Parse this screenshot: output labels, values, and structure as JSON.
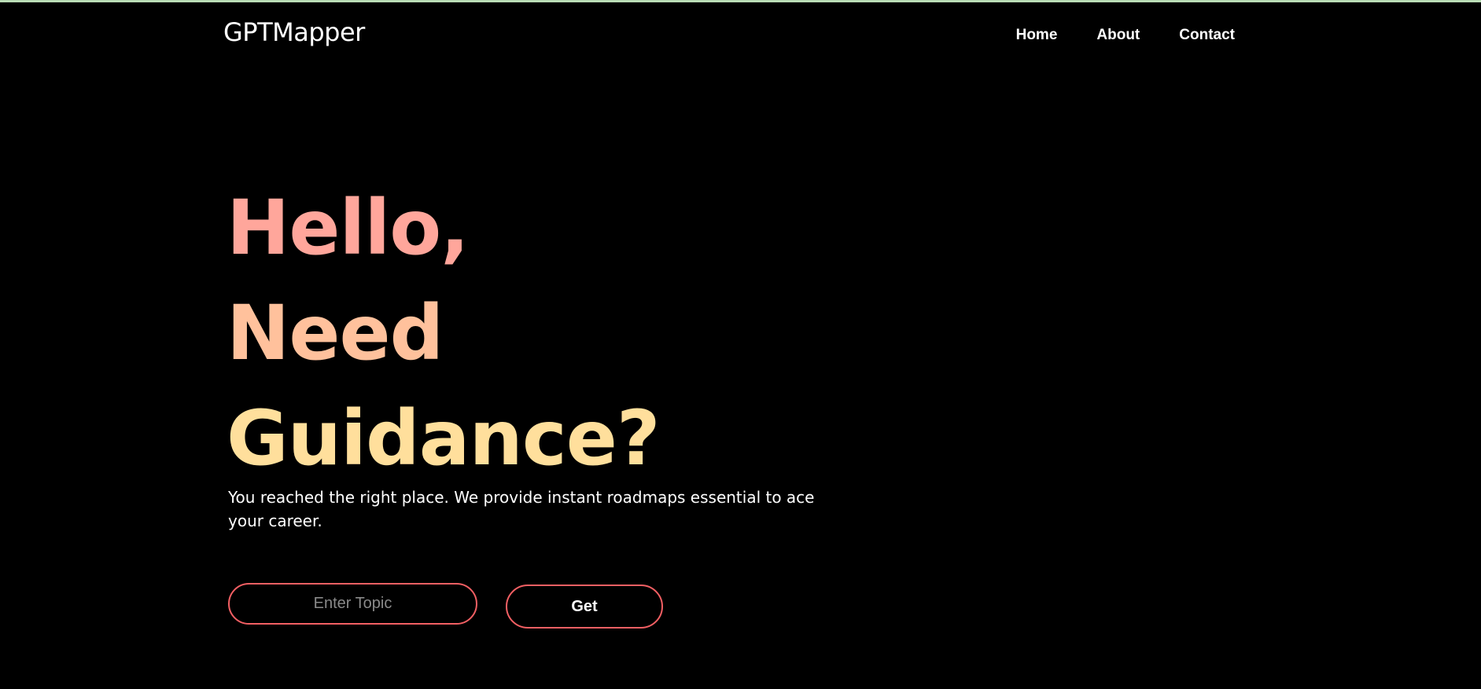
{
  "brand": {
    "name": "GPTMapper"
  },
  "nav": {
    "items": [
      {
        "label": "Home"
      },
      {
        "label": "About"
      },
      {
        "label": "Contact"
      }
    ]
  },
  "hero": {
    "title_lines": [
      "Hello,",
      "Need",
      "Guidance?"
    ],
    "tagline": "You reached the right place. We provide instant roadmaps essential to ace your career."
  },
  "search": {
    "placeholder": "Enter Topic",
    "value": "",
    "button_label": "Get"
  },
  "colors": {
    "background": "#000000",
    "top_accent": "#b9dcb5",
    "title_line_1": "#ffa69b",
    "title_line_2": "#ffc19c",
    "title_line_3": "#ffdf9c",
    "button_border": "#f25f63"
  }
}
